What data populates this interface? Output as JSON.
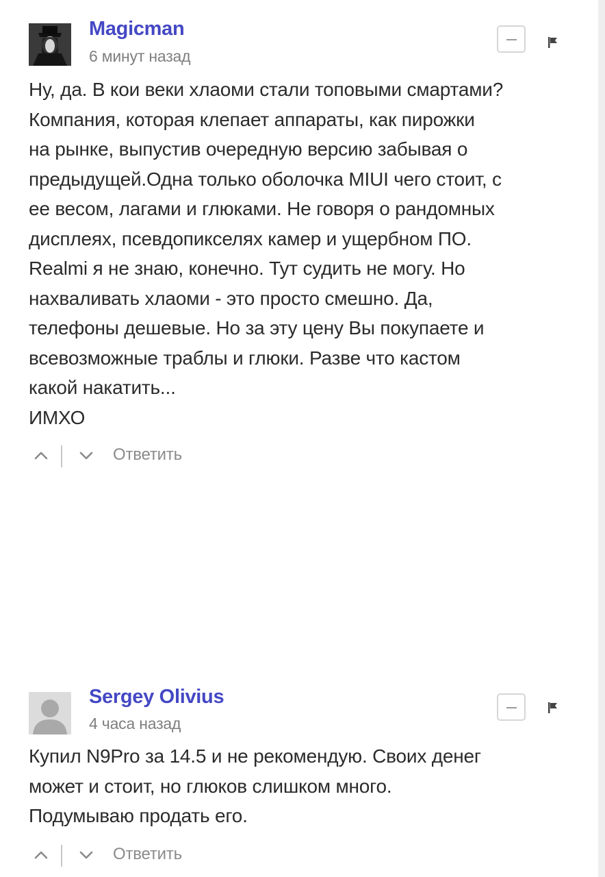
{
  "comments": [
    {
      "author": "Magicman",
      "time": "6 минут назад",
      "avatar": "dark-figure-avatar",
      "lines": [
        "Ну, да. В кои веки хлаоми стали топовыми смартами?",
        "Компания, которая клепает аппараты, как пирожки",
        "на рынке, выпустив очередную версию забывая о",
        "предыдущей.Одна только оболочка MIUI чего стоит, с",
        "ее весом, лагами и глюками. Не говоря о рандомных",
        "дисплеях, псевдопикселях камер и ущербном ПО.",
        "Realmi я не знаю, конечно. Тут судить не могу. Но",
        "нахваливать хлаоми - это просто смешно. Да,",
        "телефоны дешевые. Но за эту цену Вы покупаете и",
        "всевозможные траблы и глюки. Разве что кастом",
        "какой накатить...",
        "ИМХО"
      ],
      "reply_label": "Ответить"
    },
    {
      "author": "Sergey Olivius",
      "time": "4 часа назад",
      "avatar": "default-user-avatar",
      "lines": [
        "Купил N9Pro за 14.5 и не рекомендую. Своих денег",
        "может и стоит, но глюков слишком много.",
        "Подумываю продать его."
      ],
      "reply_label": "Ответить"
    }
  ],
  "icons": {
    "collapse": "minus-icon",
    "report": "flag-icon",
    "upvote": "chevron-up-icon",
    "downvote": "chevron-down-icon"
  },
  "colors": {
    "author": "#4448c4",
    "text": "#2b2b2b",
    "muted": "#8a8a8a"
  }
}
